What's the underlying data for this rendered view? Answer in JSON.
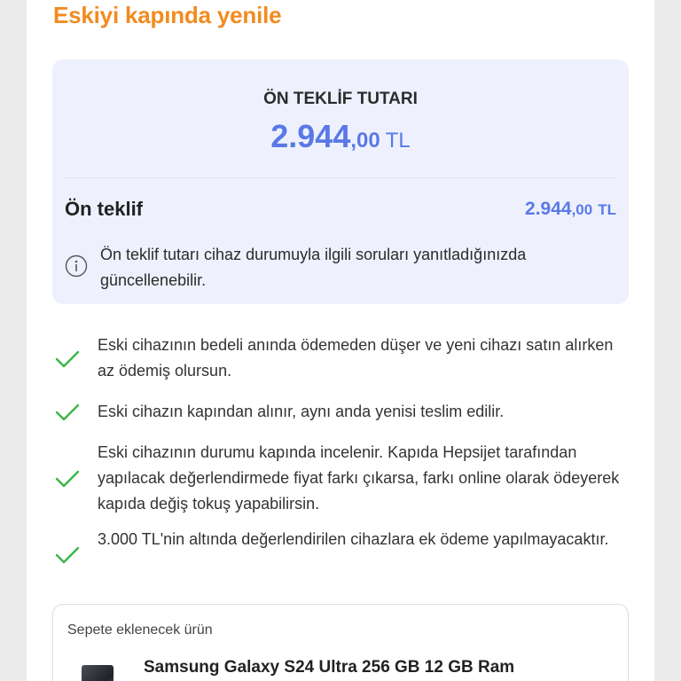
{
  "heading": "Eskiyi kapında yenile",
  "offer": {
    "title": "ÖN TEKLİF TUTARI",
    "amount_int": "2.944",
    "amount_dec": ",00",
    "currency": "TL",
    "row_label": "Ön teklif",
    "row_amount_int": "2.944",
    "row_amount_dec": ",00",
    "row_currency": "TL",
    "info_text": "Ön teklif tutarı cihaz durumuyla ilgili soruları yanıtladığınızda güncellenebilir."
  },
  "benefits": [
    "Eski cihazının bedeli anında ödemeden düşer ve yeni cihazı satın alırken az ödemiş olursun.",
    "Eski cihazın kapından alınır, aynı anda yenisi teslim edilir.",
    "Eski cihazının durumu kapında incelenir. Kapıda Hepsijet tarafından yapılacak değerlendirmede fiyat farkı çıkarsa, farkı online olarak ödeyerek kapıda değiş tokuş yapabilirsin.",
    "3.000 TL'nin altında değerlendirilen cihazlara ek ödeme yapılmayacaktır."
  ],
  "cart": {
    "label": "Sepete eklenecek ürün",
    "product_name": "Samsung Galaxy S24 Ultra 256 GB 12 GB Ram"
  },
  "colors": {
    "accent_orange": "#f28b1f",
    "accent_blue": "#5a79e6",
    "check_green": "#3bb54a",
    "offer_bg": "#eef1fd"
  }
}
